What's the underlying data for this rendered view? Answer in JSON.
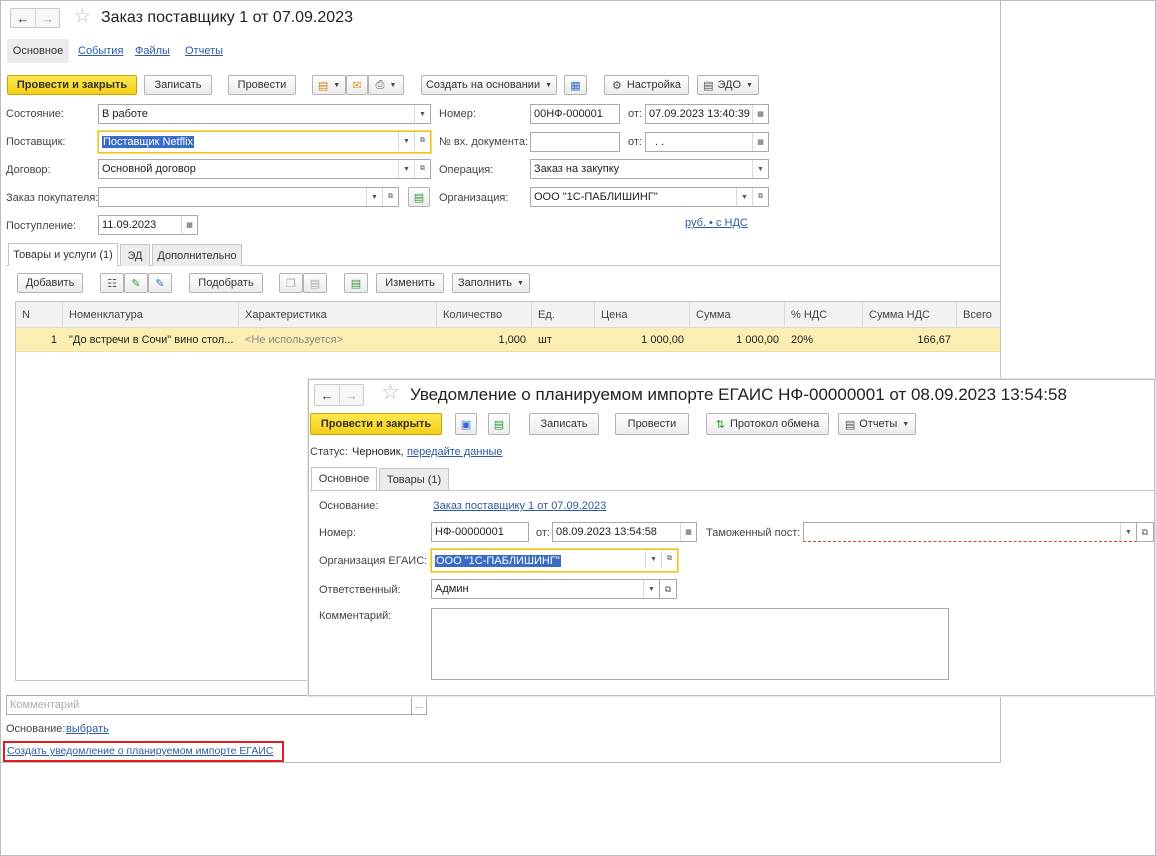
{
  "order": {
    "title": "Заказ поставщику 1 от 07.09.2023",
    "tabs": [
      "Основное",
      "События",
      "Файлы",
      "Отчеты"
    ],
    "toolbar": {
      "post_close": "Провести и закрыть",
      "save": "Записать",
      "post": "Провести",
      "create_based": "Создать на основании",
      "settings": "Настройка",
      "edo": "ЭДО"
    },
    "fields": {
      "state_label": "Состояние:",
      "state_value": "В работе",
      "supplier_label": "Поставщик:",
      "supplier_value": "Поставщик Netflix",
      "contract_label": "Договор:",
      "contract_value": "Основной договор",
      "customer_order_label": "Заказ покупателя:",
      "customer_order_value": "",
      "receipt_label": "Поступление:",
      "receipt_value": "11.09.2023",
      "number_label": "Номер:",
      "number_value": "00НФ-000001",
      "from_label": "от:",
      "from_value": "07.09.2023 13:40:39",
      "in_doc_label": "№ вх. документа:",
      "in_doc_value": "",
      "in_doc_from_label": "от:",
      "in_doc_date": " .  .",
      "operation_label": "Операция:",
      "operation_value": "Заказ на закупку",
      "org_label": "Организация:",
      "org_value": "ООО \"1С-ПАБЛИШИНГ\"",
      "price_link": "руб. • с НДС"
    },
    "content_tabs": [
      "Товары и услуги (1)",
      "ЭД",
      "Дополнительно"
    ],
    "table_toolbar": {
      "add": "Добавить",
      "pick": "Подобрать",
      "change": "Изменить",
      "fill": "Заполнить"
    },
    "table": {
      "columns": [
        "N",
        "Номенклатура",
        "Характеристика",
        "Количество",
        "Ед.",
        "Цена",
        "Сумма",
        "% НДС",
        "Сумма НДС",
        "Всего"
      ],
      "rows": [
        [
          "1",
          "\"До встречи в Сочи\" вино стол...",
          "<Не используется>",
          "1,000",
          "шт",
          "1 000,00",
          "1 000,00",
          "20%",
          "166,67",
          ""
        ]
      ]
    },
    "comment_placeholder": "Комментарий",
    "basis_label": "Основание:",
    "basis_link": "выбрать",
    "create_notice_link": "Создать уведомление о планируемом импорте ЕГАИС"
  },
  "notice": {
    "title": "Уведомление о планируемом импорте ЕГАИС НФ-00000001 от 08.09.2023 13:54:58",
    "toolbar": {
      "post_close": "Провести и закрыть",
      "save": "Записать",
      "post": "Провести",
      "protocol": "Протокол обмена",
      "reports": "Отчеты"
    },
    "status_label": "Статус:",
    "status_value": "Черновик,",
    "status_link": "передайте данные",
    "tabs": [
      "Основное",
      "Товары (1)"
    ],
    "fields": {
      "basis_label": "Основание:",
      "basis_link": "Заказ поставщику 1 от 07.09.2023",
      "number_label": "Номер:",
      "number_value": "НФ-00000001",
      "from_label": "от:",
      "from_value": "08.09.2023 13:54:58",
      "customs_label": "Таможенный пост:",
      "customs_value": "",
      "org_label": "Организация ЕГАИС:",
      "org_value": "ООО \"1С-ПАБЛИШИНГ\"",
      "responsible_label": "Ответственный:",
      "responsible_value": "Админ",
      "comment_label": "Комментарий:",
      "comment_value": ""
    }
  },
  "colors": {
    "accent_yellow": "#f4cf1a",
    "link_blue": "#2d5aa0",
    "highlight_red": "#e01e1e",
    "selected_row": "#fbeeb3"
  }
}
